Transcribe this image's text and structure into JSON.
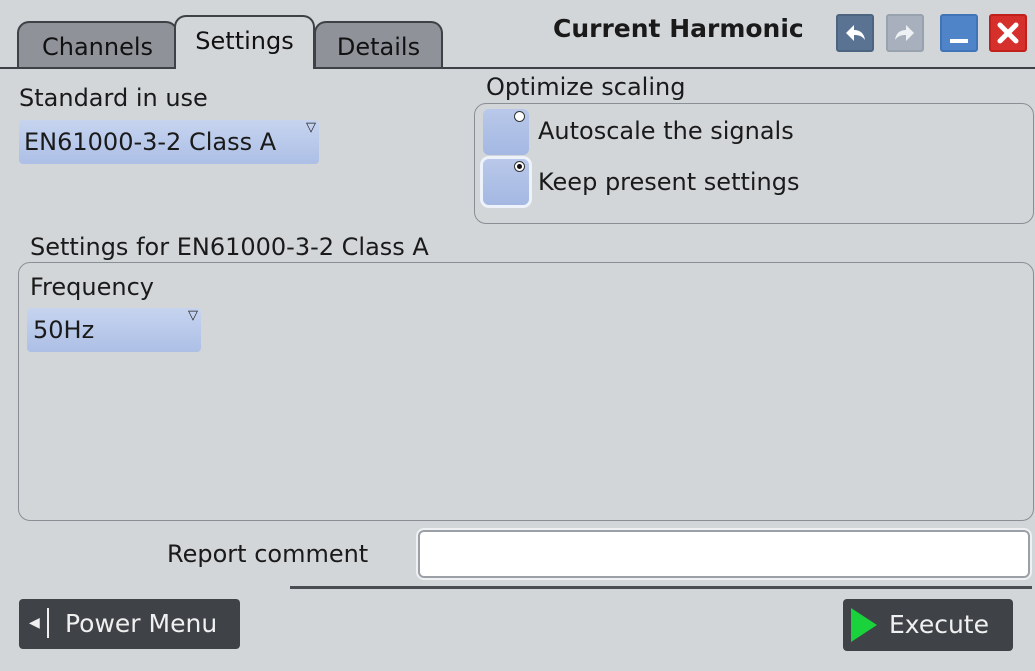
{
  "tabs": [
    {
      "label": "Channels"
    },
    {
      "label": "Settings"
    },
    {
      "label": "Details"
    }
  ],
  "dialog": {
    "title": "Current Harmonic",
    "icons": {
      "undo": "undo-arrow-icon",
      "redo": "redo-arrow-icon",
      "minimize": "minimize-icon",
      "close": "close-x-icon"
    }
  },
  "standard": {
    "label": "Standard in use",
    "value": "EN61000-3-2 Class A"
  },
  "optimize": {
    "label": "Optimize scaling",
    "options": [
      {
        "label": "Autoscale the signals",
        "checked": false
      },
      {
        "label": "Keep present settings",
        "checked": true
      }
    ]
  },
  "settings_group": {
    "label": "Settings for EN61000-3-2 Class A",
    "frequency_label": "Frequency",
    "frequency_value": "50Hz"
  },
  "report": {
    "label": "Report comment",
    "value": ""
  },
  "footer": {
    "power_menu_label": "Power Menu",
    "execute_label": "Execute"
  },
  "colors": {
    "background": "#d3d6d9",
    "control_blue": "#adbfe6",
    "close_red": "#d6302c",
    "execute_green": "#19d23c"
  }
}
